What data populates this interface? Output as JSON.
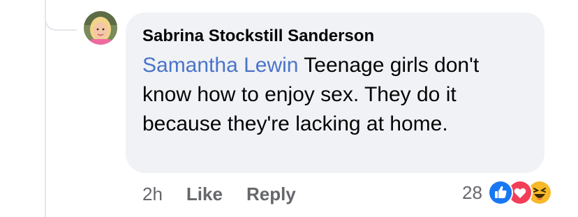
{
  "comment": {
    "author": "Sabrina Stockstill Sanderson",
    "mention": "Samantha Lewin",
    "text": " Teenage girls don't know how to enjoy sex. They do it because they're lacking at home."
  },
  "actions": {
    "time": "2h",
    "like_label": "Like",
    "reply_label": "Reply"
  },
  "reactions": {
    "count": "28",
    "types": [
      "like-icon",
      "love-icon",
      "haha-icon"
    ]
  },
  "colors": {
    "bubble": "#f0f2f5",
    "mention": "#4a74c9",
    "secondary_text": "#65676b",
    "like": "#1877f2",
    "love": "#f33e58",
    "haha": "#f7b928"
  }
}
